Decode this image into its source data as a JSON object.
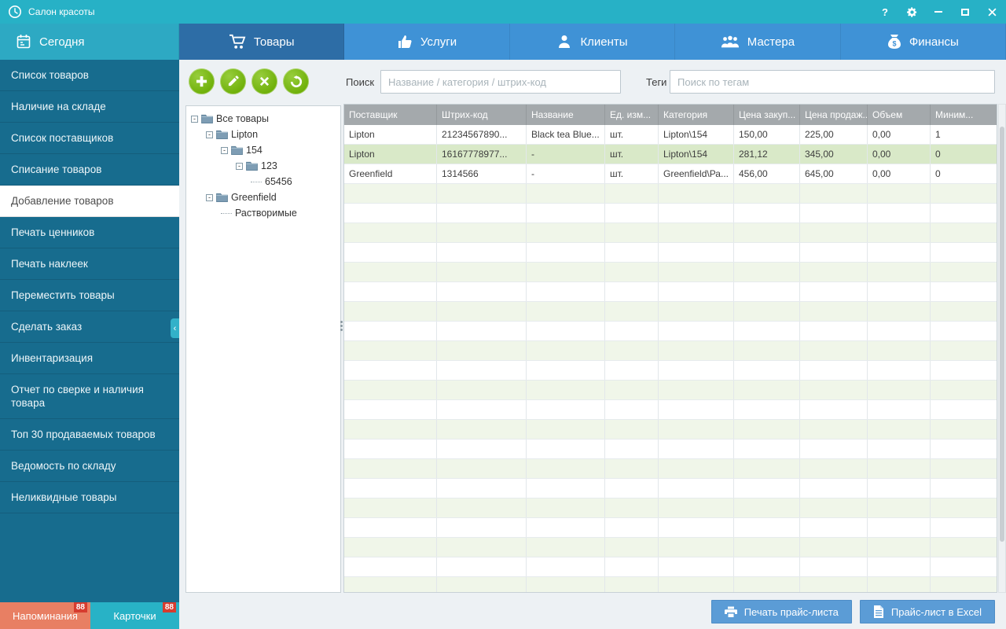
{
  "colors": {
    "titlebar_teal": "#27b1c6",
    "tab_blue": "#3f92d6",
    "tab_active_blue": "#2d6da6",
    "sidebar_dark": "#176c8e",
    "accent_green": "#76b711",
    "selected_row_green": "#d9e9c8",
    "alt_row_green": "#f0f6e9",
    "table_header_gray": "#a4a9ac",
    "footer_salmon": "#e87f63",
    "badge_red": "#d63c2f",
    "button_blue": "#5b9cd6"
  },
  "titlebar": {
    "title": "Салон красоты",
    "help": "?"
  },
  "tabs": [
    {
      "label": "Сегодня"
    },
    {
      "label": "Товары"
    },
    {
      "label": "Услуги"
    },
    {
      "label": "Клиенты"
    },
    {
      "label": "Мастера"
    },
    {
      "label": "Финансы"
    }
  ],
  "sidebar": {
    "items": [
      {
        "label": "Список товаров",
        "active": false
      },
      {
        "label": "Наличие на складе",
        "active": false
      },
      {
        "label": "Список поставщиков",
        "active": false
      },
      {
        "label": "Списание товаров",
        "active": false
      },
      {
        "label": "Добавление товаров",
        "active": true
      },
      {
        "label": "Печать ценников",
        "active": false
      },
      {
        "label": "Печать наклеек",
        "active": false
      },
      {
        "label": "Переместить товары",
        "active": false
      },
      {
        "label": "Сделать заказ",
        "active": false
      },
      {
        "label": "Инвентаризация",
        "active": false
      },
      {
        "label": "Отчет по сверке и наличия товара",
        "active": false
      },
      {
        "label": "Топ 30 продаваемых товаров",
        "active": false
      },
      {
        "label": "Ведомость по складу",
        "active": false
      },
      {
        "label": "Неликвидные товары",
        "active": false
      }
    ],
    "footer": [
      {
        "label": "Напоминания",
        "badge": "88"
      },
      {
        "label": "Карточки",
        "badge": "88"
      }
    ]
  },
  "toolbar": {
    "search_label": "Поиск",
    "search_placeholder": "Название / категория / штрих-код",
    "tags_label": "Теги",
    "tags_placeholder": "Поиск по тегам"
  },
  "tree": {
    "items": [
      {
        "label": "Все товары",
        "level": 0,
        "folder": true
      },
      {
        "label": "Lipton",
        "level": 1,
        "folder": true
      },
      {
        "label": "154",
        "level": 2,
        "folder": true
      },
      {
        "label": "123",
        "level": 3,
        "folder": true
      },
      {
        "label": "65456",
        "level": 4,
        "folder": false
      },
      {
        "label": "Greenfield",
        "level": 1,
        "folder": true
      },
      {
        "label": "Растворимые",
        "level": 2,
        "folder": false
      }
    ]
  },
  "table": {
    "columns": [
      "Поставщик",
      "Штрих-код",
      "Название",
      "Ед. изм...",
      "Категория",
      "Цена закуп...",
      "Цена продаж...",
      "Объем",
      "Миним..."
    ],
    "rows": [
      [
        "Lipton",
        "21234567890...",
        "Black tea Blue...",
        "шт.",
        "Lipton\\154",
        "150,00",
        "225,00",
        "0,00",
        "1"
      ],
      [
        "Lipton",
        "16167778977...",
        "-",
        "шт.",
        "Lipton\\154",
        "281,12",
        "345,00",
        "0,00",
        "0"
      ],
      [
        "Greenfield",
        "1314566",
        "-",
        "шт.",
        "Greenfield\\Ра...",
        "456,00",
        "645,00",
        "0,00",
        "0"
      ]
    ],
    "selected_row_index": 1
  },
  "footer_buttons": {
    "print": "Печать прайс-листа",
    "excel": "Прайс-лист в Excel"
  }
}
